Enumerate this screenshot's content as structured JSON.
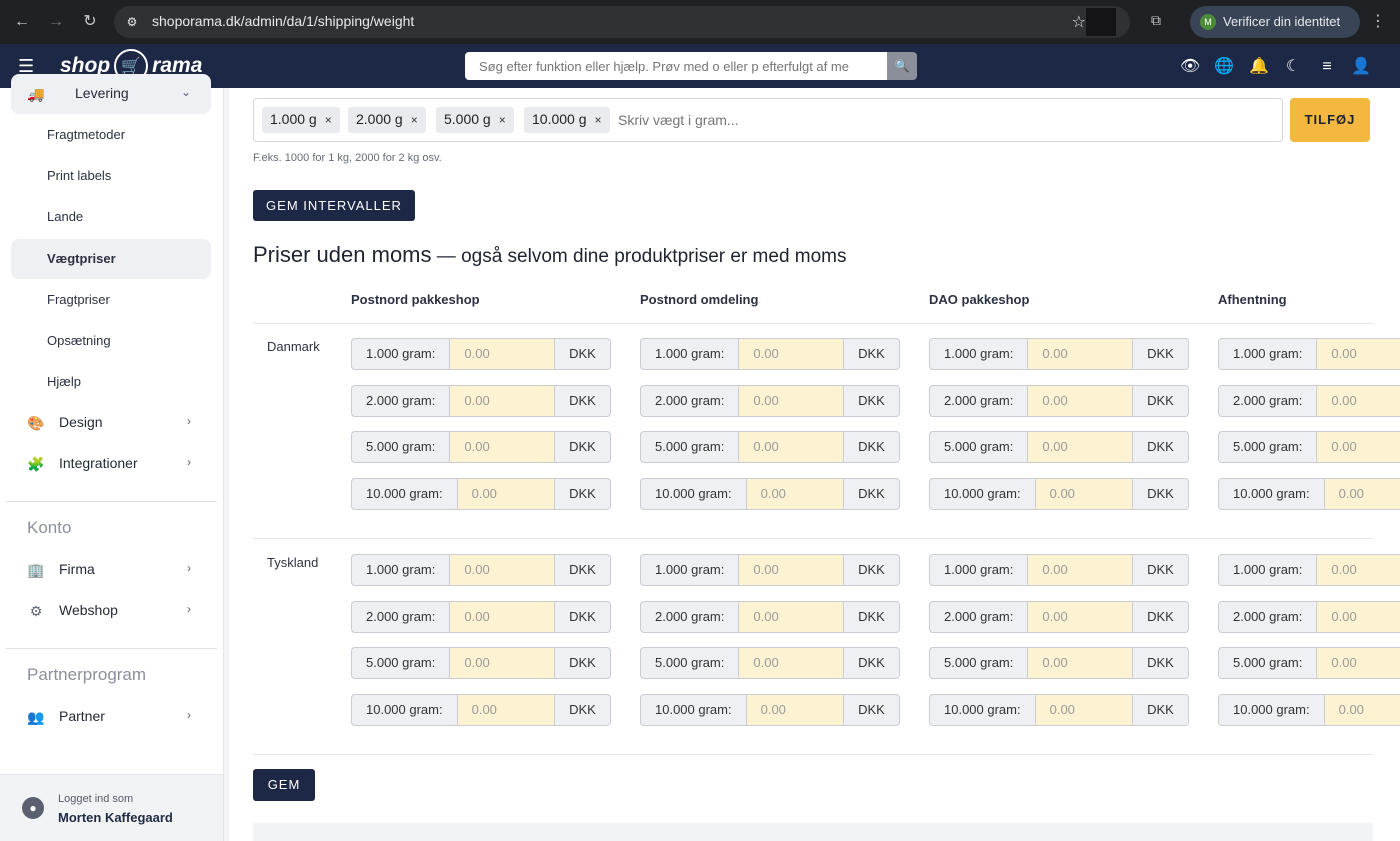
{
  "browser": {
    "url": "shoporama.dk/admin/da/1/shipping/weight",
    "verify_label": "Verificer din identitet",
    "verify_avatar": "M"
  },
  "topbar": {
    "logo_left": "shop",
    "logo_right": "rama",
    "search_placeholder": "Søg efter funktion eller hjælp. Prøv med o eller p efterfulgt af me"
  },
  "sidebar": {
    "levering": "Levering",
    "sub_items": [
      "Fragtmetoder",
      "Print labels",
      "Lande",
      "Vægtpriser",
      "Fragtpriser",
      "Opsætning",
      "Hjælp"
    ],
    "active_sub": "Vægtpriser",
    "design": "Design",
    "integrationer": "Integrationer",
    "konto_title": "Konto",
    "firma": "Firma",
    "webshop": "Webshop",
    "partner_title": "Partnerprogram",
    "partner": "Partner",
    "logged_in_label": "Logget ind som",
    "user_name": "Morten Kaffegaard"
  },
  "intervals": {
    "tags": [
      "1.000 g",
      "2.000 g",
      "5.000 g",
      "10.000 g"
    ],
    "tag_remove": "×",
    "input_placeholder": "Skriv vægt i gram...",
    "add_label": "TILFØJ",
    "hint": "F.eks. 1000 for 1 kg, 2000 for 2 kg osv.",
    "save_label": "GEM INTERVALLER"
  },
  "prices": {
    "heading_main": "Priser uden moms",
    "heading_sub": " — også selvom dine produktpriser er med moms",
    "columns": [
      "Postnord pakkeshop",
      "Postnord omdeling",
      "DAO pakkeshop",
      "Afhentning"
    ],
    "countries": [
      "Danmark",
      "Tyskland"
    ],
    "weights": [
      "1.000 gram:",
      "2.000 gram:",
      "5.000 gram:",
      "10.000 gram:"
    ],
    "value_placeholder": "0.00",
    "currency": "DKK",
    "save_label": "GEM"
  }
}
